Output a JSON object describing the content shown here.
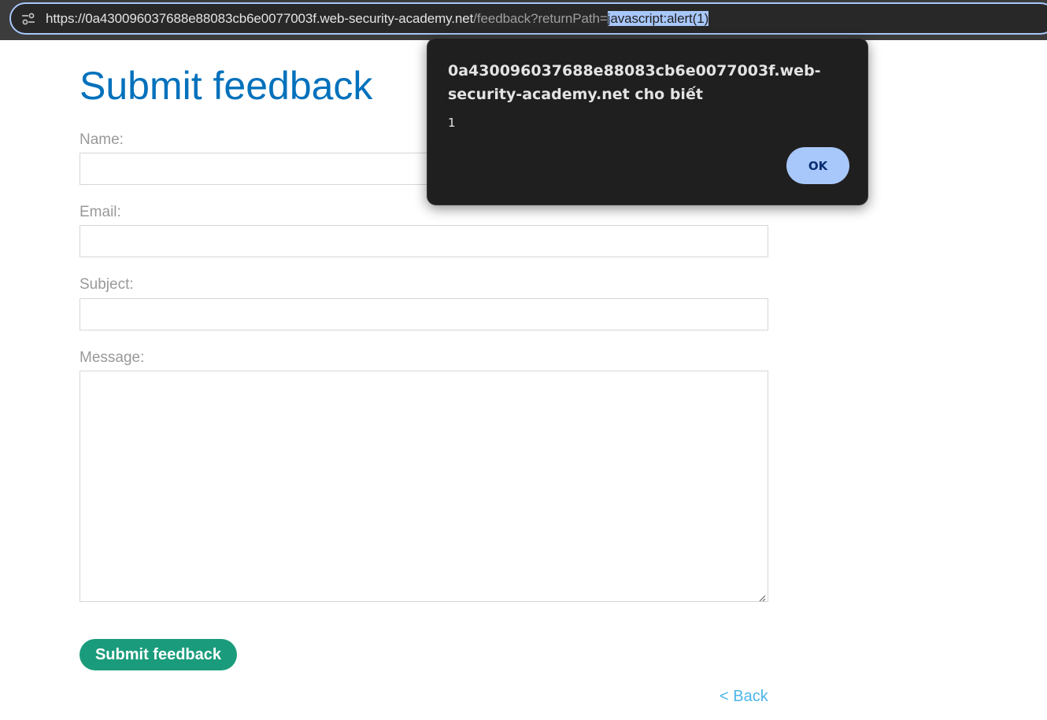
{
  "browser": {
    "url_host": "https://0a430096037688e88083cb6e0077003f.web-security-academy.net",
    "url_path": "/feedback?returnPath=",
    "url_selected": "javascript:alert(1)",
    "site_settings_icon": "tune-icon"
  },
  "page": {
    "title": "Submit feedback",
    "fields": {
      "name_label": "Name:",
      "email_label": "Email:",
      "subject_label": "Subject:",
      "message_label": "Message:"
    },
    "submit_label": "Submit feedback",
    "back_label": "< Back"
  },
  "alert": {
    "title": "0a430096037688e88083cb6e0077003f.web-security-academy.net cho biết",
    "message": "1",
    "ok_label": "OK"
  },
  "colors": {
    "title": "#0071bc",
    "submit_button": "#1a9c7c",
    "back_link": "#4cb5ea",
    "alert_background": "#1f1f1f",
    "alert_ok": "#a8c7fa",
    "url_selection": "#a8c7fa"
  }
}
